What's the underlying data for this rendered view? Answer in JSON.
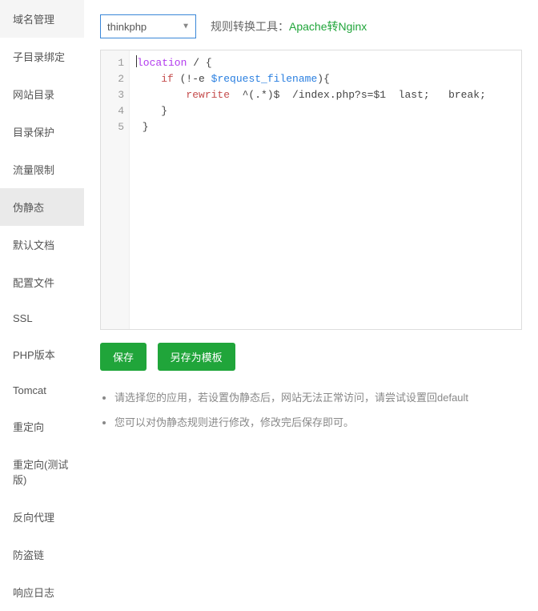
{
  "sidebar": {
    "active_index": 5,
    "items": [
      "域名管理",
      "子目录绑定",
      "网站目录",
      "目录保护",
      "流量限制",
      "伪静态",
      "默认文档",
      "配置文件",
      "SSL",
      "PHP版本",
      "Tomcat",
      "重定向",
      "重定向(测试版)",
      "反向代理",
      "防盗链",
      "响应日志"
    ]
  },
  "toolbar": {
    "select_value": "thinkphp",
    "tool_label": "规则转换工具：",
    "tool_link": "Apache转Nginx"
  },
  "editor": {
    "lines": [
      {
        "n": 1,
        "tokens": [
          {
            "cls": "tok-kw",
            "text": "location"
          },
          {
            "cls": "tok-default",
            "text": " / {"
          }
        ],
        "cursor_before": true
      },
      {
        "n": 2,
        "tokens": [
          {
            "cls": "tok-default",
            "text": "    "
          },
          {
            "cls": "tok-dir",
            "text": "if"
          },
          {
            "cls": "tok-default",
            "text": " (!-e "
          },
          {
            "cls": "tok-var",
            "text": "$request_filename"
          },
          {
            "cls": "tok-default",
            "text": "){"
          }
        ]
      },
      {
        "n": 3,
        "tokens": [
          {
            "cls": "tok-default",
            "text": "        "
          },
          {
            "cls": "tok-dir",
            "text": "rewrite"
          },
          {
            "cls": "tok-default",
            "text": "  ^(.*)$  /index.php?s=$1  last;   break;"
          }
        ]
      },
      {
        "n": 4,
        "tokens": [
          {
            "cls": "tok-default",
            "text": "    }"
          }
        ]
      },
      {
        "n": 5,
        "tokens": [
          {
            "cls": "tok-default",
            "text": " }"
          }
        ]
      }
    ]
  },
  "buttons": {
    "save": "保存",
    "save_tpl": "另存为模板"
  },
  "tips": [
    "请选择您的应用，若设置伪静态后，网站无法正常访问，请尝试设置回default",
    "您可以对伪静态规则进行修改，修改完后保存即可。"
  ]
}
